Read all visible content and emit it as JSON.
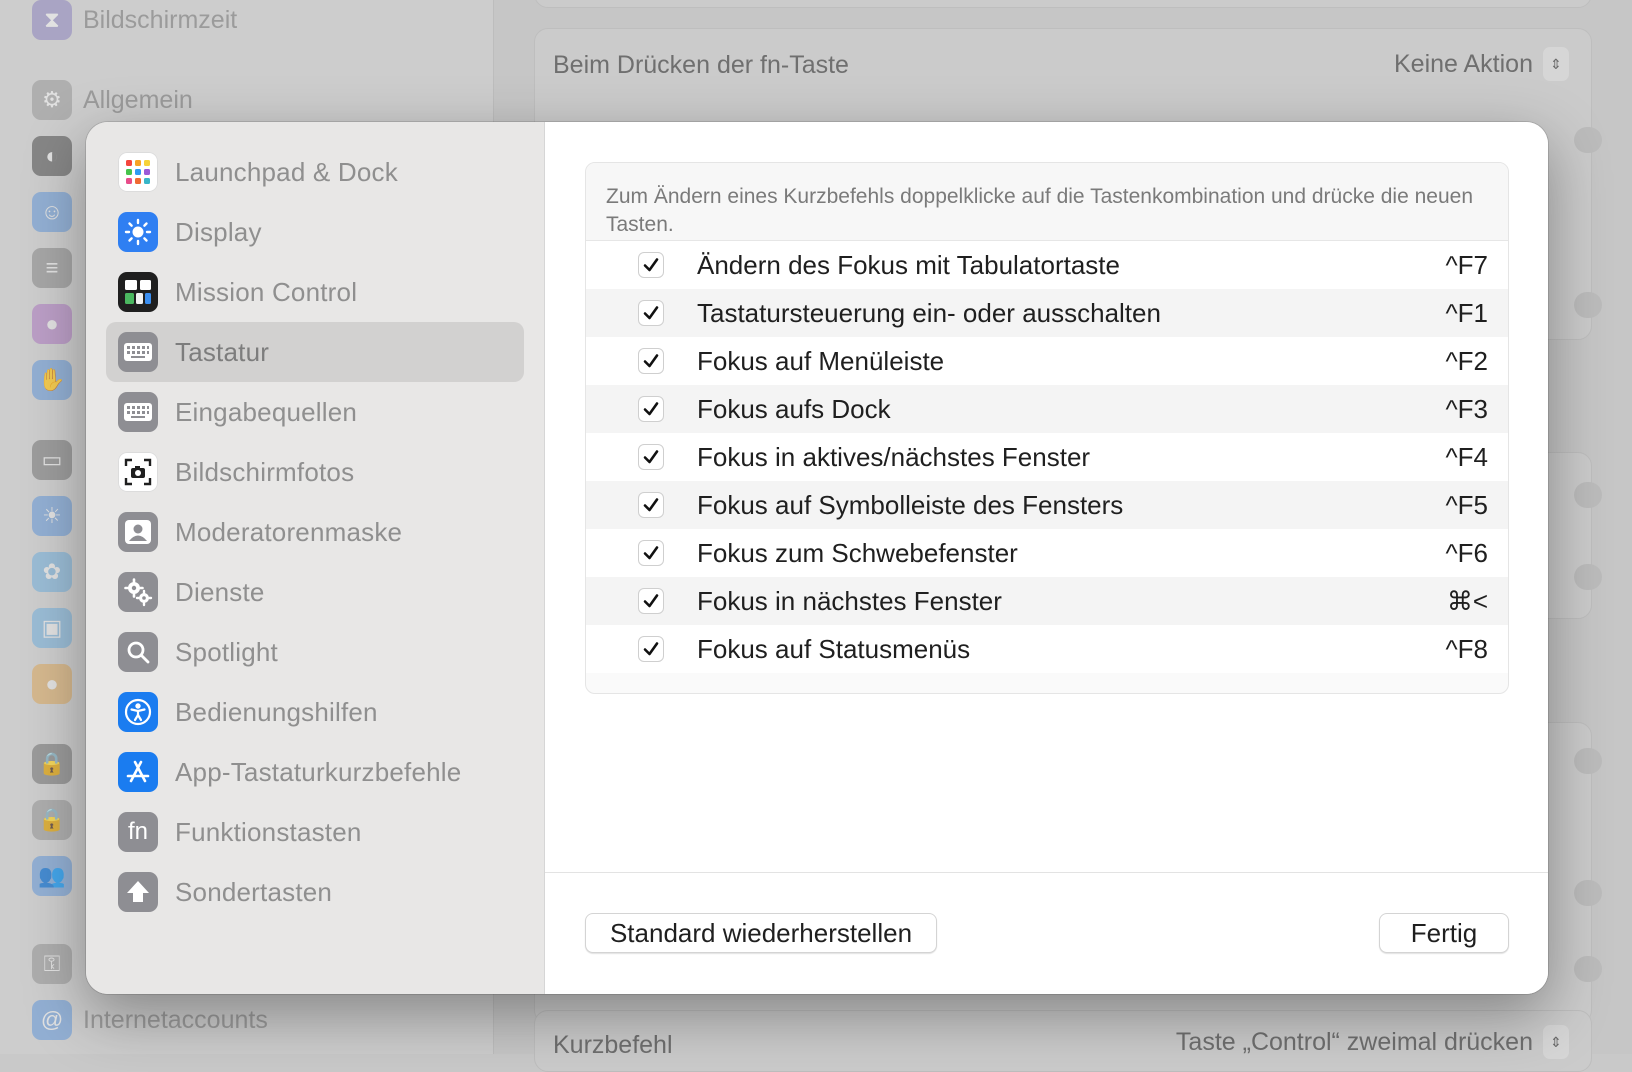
{
  "background_window": {
    "sidebar_items": [
      {
        "label": "Bildschirmzeit",
        "icon": "hourglass-icon"
      },
      {
        "label": "Allgemein",
        "icon": "gear-icon"
      },
      {
        "label": "Internetaccounts",
        "icon": "at-icon"
      }
    ],
    "rows": {
      "fn_label": "Beim Drücken der fn-Taste",
      "fn_value": "Keine Aktion",
      "shortcut_label": "Kurzbefehl",
      "shortcut_value": "Taste „Control“ zweimal drücken"
    }
  },
  "sidebar": {
    "items": [
      {
        "label": "Launchpad & Dock",
        "icon": "launchpad-icon",
        "color": "#ffffff"
      },
      {
        "label": "Display",
        "icon": "sun-icon",
        "color": "#2f7ff2"
      },
      {
        "label": "Mission Control",
        "icon": "mission-control-icon",
        "color": "#1f1f1f"
      },
      {
        "label": "Tastatur",
        "icon": "keyboard-icon",
        "color": "#8e8e93",
        "selected": true
      },
      {
        "label": "Eingabequellen",
        "icon": "keyboard-icon",
        "color": "#8e8e93"
      },
      {
        "label": "Bildschirmfotos",
        "icon": "screenshot-icon",
        "color": "#ffffff"
      },
      {
        "label": "Moderatorenmaske",
        "icon": "person-icon",
        "color": "#8e8e93"
      },
      {
        "label": "Dienste",
        "icon": "gears-icon",
        "color": "#8e8e93"
      },
      {
        "label": "Spotlight",
        "icon": "magnifier-icon",
        "color": "#8e8e93"
      },
      {
        "label": "Bedienungshilfen",
        "icon": "accessibility-icon",
        "color": "#1a7cf0"
      },
      {
        "label": "App-Tastaturkurzbefehle",
        "icon": "app-store-icon",
        "color": "#1a7cf0"
      },
      {
        "label": "Funktionstasten",
        "icon": "fn-icon",
        "color": "#8e8e93"
      },
      {
        "label": "Sondertasten",
        "icon": "shift-arrow-icon",
        "color": "#8e8e93"
      }
    ]
  },
  "main": {
    "hint": "Zum Ändern eines Kurzbefehls doppelklicke auf die Tastenkombination und drücke die neuen Tasten.",
    "shortcuts": [
      {
        "label": "Ändern des Fokus mit Tabulatortaste",
        "keys": "^F7",
        "checked": true
      },
      {
        "label": "Tastatursteuerung ein- oder ausschalten",
        "keys": "^F1",
        "checked": true
      },
      {
        "label": "Fokus auf Menüleiste",
        "keys": "^F2",
        "checked": true
      },
      {
        "label": "Fokus aufs Dock",
        "keys": "^F3",
        "checked": true
      },
      {
        "label": "Fokus in aktives/nächstes Fenster",
        "keys": "^F4",
        "checked": true
      },
      {
        "label": "Fokus auf Symbolleiste des Fensters",
        "keys": "^F5",
        "checked": true
      },
      {
        "label": "Fokus zum Schwebefenster",
        "keys": "^F6",
        "checked": true
      },
      {
        "label": "Fokus in nächstes Fenster",
        "keys": "⌘<",
        "checked": true
      },
      {
        "label": "Fokus auf Statusmenüs",
        "keys": "^F8",
        "checked": true
      }
    ]
  },
  "footer": {
    "restore_label": "Standard wiederherstellen",
    "done_label": "Fertig"
  }
}
